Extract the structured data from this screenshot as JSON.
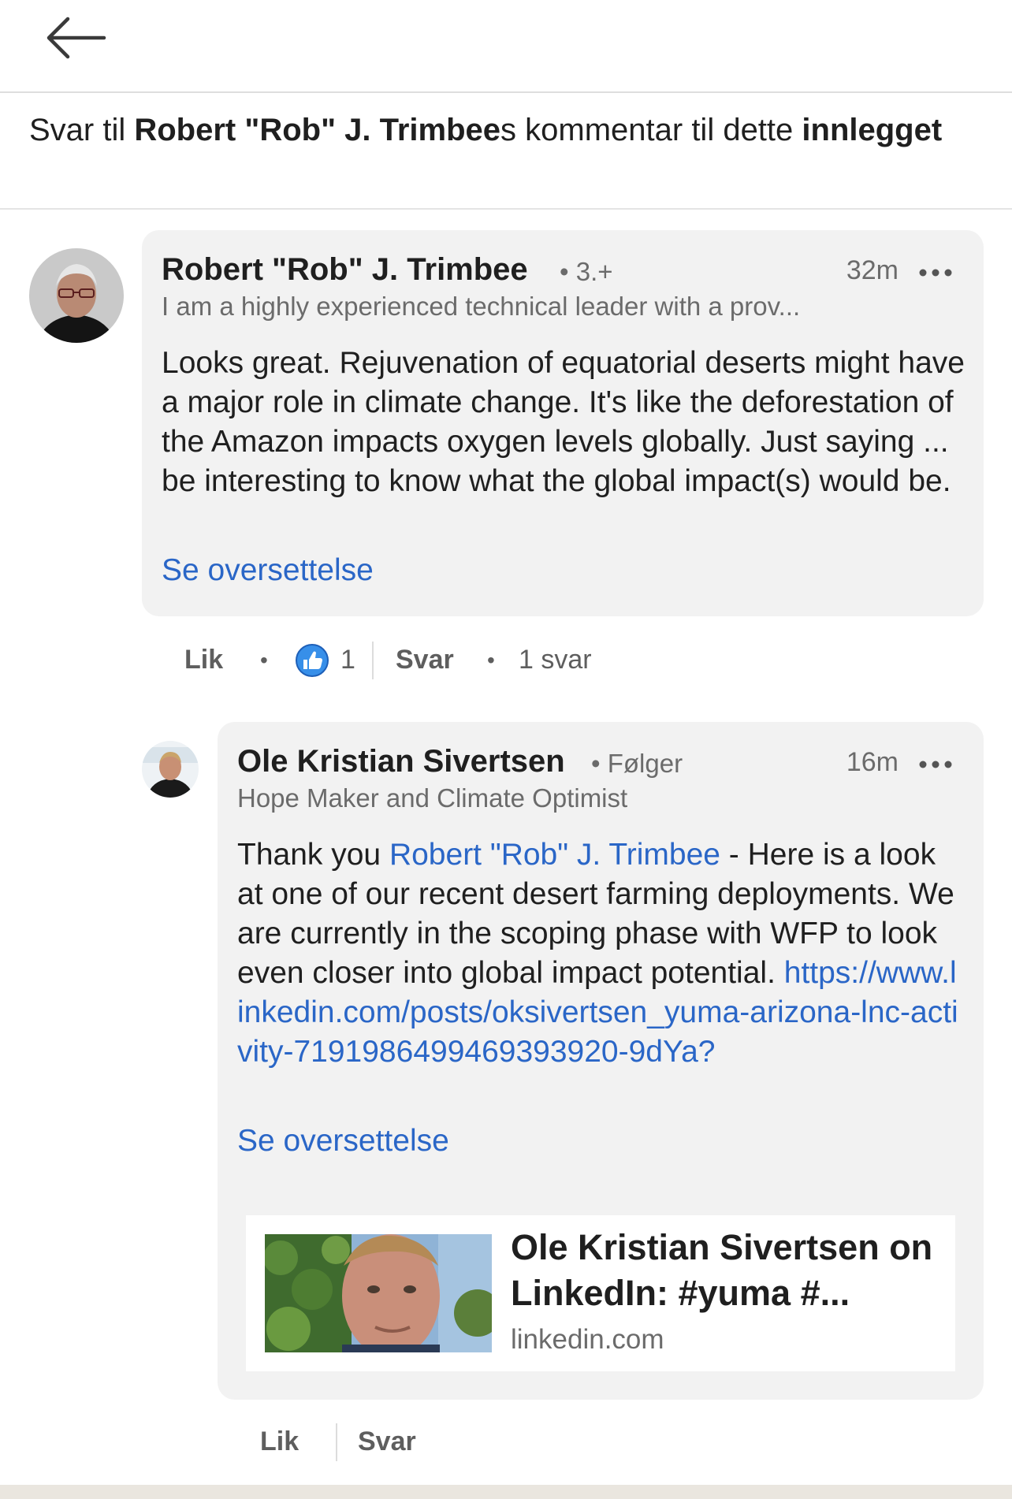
{
  "header": {
    "back_icon": "arrow-left-icon"
  },
  "context": {
    "prefix": "Svar til ",
    "author": "Robert \"Rob\" J. Trimbee",
    "middle": "s kommentar til dette ",
    "post_word": "innlegget"
  },
  "comment": {
    "author": "Robert \"Rob\" J. Trimbee",
    "degree": "• 3.+",
    "time": "32m",
    "more_icon": "more-horizontal-icon",
    "headline": "I am a highly experienced technical leader with a prov...",
    "text": "Looks great. Rejuvenation of equatorial deserts might have a major role in climate change. It's like the deforestation of the Amazon impacts oxygen levels globally. Just saying ... be interesting to know what the global impact(s) would be.",
    "translate": "Se oversettelse",
    "actions": {
      "like": "Lik",
      "reaction_icon": "thumbs-up-icon",
      "reaction_count": "1",
      "reply": "Svar",
      "reply_count": "1 svar"
    }
  },
  "reply": {
    "author": "Ole Kristian Sivertsen",
    "degree": "• Følger",
    "time": "16m",
    "more_icon": "more-horizontal-icon",
    "headline": "Hope Maker and Climate Optimist",
    "text_before": "Thank you ",
    "mention": "Robert \"Rob\" J. Trimbee",
    "text_after": " - Here is a look at one of our recent desert farming deployments. We are currently in the scoping phase with WFP to look even closer into global impact potential. ",
    "url": "https://www.linkedin.com/posts/oksivertsen_yuma-arizona-lnc-activity-7191986499469393920-9dYa?",
    "translate": "Se oversettelse",
    "preview": {
      "title": "Ole Kristian Sivertsen on LinkedIn: #yuma #...",
      "domain": "linkedin.com"
    },
    "actions": {
      "like": "Lik",
      "reply": "Svar"
    }
  },
  "colors": {
    "link": "#2a66c7",
    "bubble": "#f2f2f2",
    "reaction": "#378fe9"
  }
}
